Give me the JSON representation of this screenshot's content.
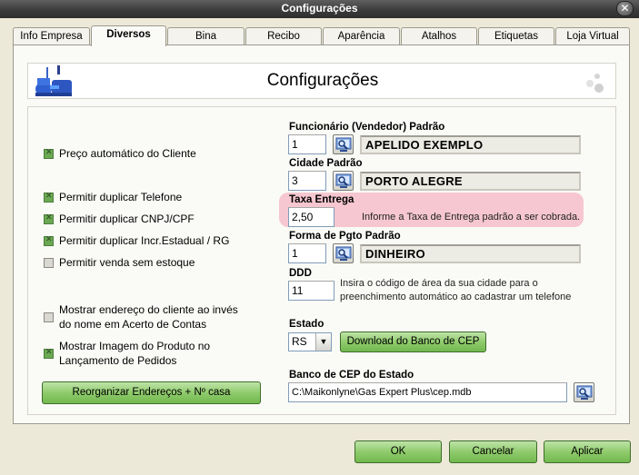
{
  "window": {
    "title": "Configurações",
    "close": "✕"
  },
  "tabs": [
    "Info Empresa",
    "Diversos",
    "Bina",
    "Recibo",
    "Aparência",
    "Atalhos",
    "Etiquetas",
    "Loja Virtual"
  ],
  "active_tab": "Diversos",
  "header": {
    "title": "Configurações"
  },
  "checkboxes": [
    {
      "label": "Preço automático do Cliente",
      "checked": true
    },
    {
      "label": "Permitir duplicar Telefone",
      "checked": true
    },
    {
      "label": "Permitir duplicar CNPJ/CPF",
      "checked": true
    },
    {
      "label": "Permitir duplicar Incr.Estadual / RG",
      "checked": true
    },
    {
      "label": "Permitir venda sem estoque",
      "checked": false
    },
    {
      "label_line1": "Mostrar endereço do cliente ao invés",
      "label_line2": "do nome em Acerto de Contas",
      "checked": false
    },
    {
      "label_line1": "Mostrar Imagem do Produto no",
      "label_line2": "Lançamento de Pedidos",
      "checked": true
    }
  ],
  "reorganize_button": "Reorganizar Endereços + Nº casa",
  "fields": {
    "funcionario": {
      "label": "Funcionário (Vendedor) Padrão",
      "code": "1",
      "name": "APELIDO EXEMPLO"
    },
    "cidade": {
      "label": "Cidade Padrão",
      "code": "3",
      "name": "PORTO ALEGRE"
    },
    "taxa": {
      "label": "Taxa Entrega",
      "value": "2,50",
      "hint": "Informe a Taxa de Entrega padrão a ser cobrada."
    },
    "forma_pgto": {
      "label": "Forma de Pgto Padrão",
      "code": "1",
      "name": "DINHEIRO"
    },
    "ddd": {
      "label": "DDD",
      "value": "11",
      "hint_line1": "Insira o código de área da sua cidade para o",
      "hint_line2": "preenchimento automático ao cadastrar um telefone"
    },
    "estado": {
      "label": "Estado",
      "value": "RS",
      "download_button": "Download do Banco de CEP"
    },
    "banco_cep": {
      "label": "Banco de CEP do Estado",
      "path": "C:\\Maikonlyne\\Gas Expert Plus\\cep.mdb"
    }
  },
  "footer": {
    "ok": "OK",
    "cancel": "Cancelar",
    "apply": "Aplicar"
  },
  "colors": {
    "accent_green": "#8fcb6c",
    "highlight_pink": "#f6c7d0",
    "titlebar": "#3c3c3c"
  }
}
